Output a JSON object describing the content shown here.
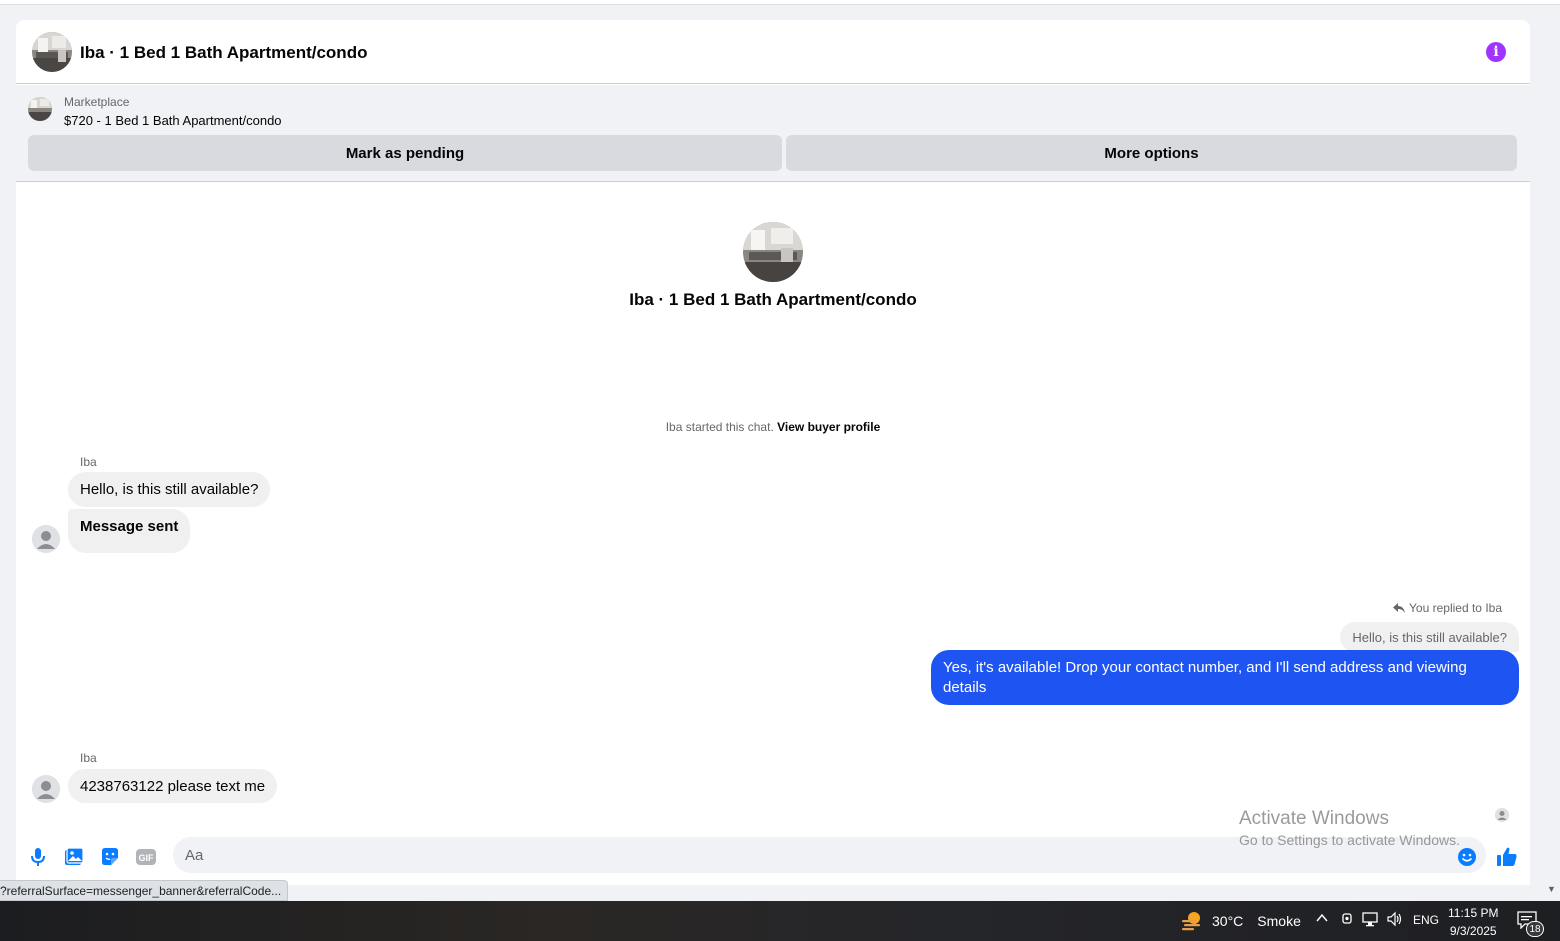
{
  "header": {
    "title": "Iba · 1 Bed 1 Bath Apartment/condo",
    "info_icon": "info-icon",
    "info_label": "i"
  },
  "marketplace": {
    "label": "Marketplace",
    "item": "$720 - 1 Bed 1 Bath Apartment/condo",
    "mark_pending": "Mark as pending",
    "more_options": "More options"
  },
  "intro": {
    "title": "Iba · 1 Bed 1 Bath Apartment/condo",
    "started_text": "Iba started this chat.",
    "view_profile": "View buyer profile"
  },
  "messages": {
    "group1": {
      "sender": "Iba",
      "msg1": "Hello, is this still available?",
      "msg2": "Message sent"
    },
    "reply": {
      "replied_label": "You replied to Iba",
      "quoted": "Hello, is this still available?",
      "text": "Yes, it's available! Drop your contact number, and I'll send address and viewing details"
    },
    "group2": {
      "sender": "Iba",
      "msg1": "4238763122 please text me"
    }
  },
  "composer": {
    "placeholder": "Aa",
    "icons": [
      "microphone-icon",
      "photo-icon",
      "sticker-icon",
      "gif-icon",
      "emoji-icon",
      "like-icon"
    ],
    "gif_label": "GIF"
  },
  "watermark": {
    "title": "Activate Windows",
    "subtitle": "Go to Settings to activate Windows."
  },
  "status_bar": {
    "url": "?referralSurface=messenger_banner&referralCode..."
  },
  "taskbar": {
    "temperature": "30°C",
    "weather": "Smoke",
    "language": "ENG",
    "time": "11:15 PM",
    "date": "9/3/2025",
    "notifications": "18"
  },
  "colors": {
    "accent": "#1e55f2",
    "info": "#a033ff",
    "composer_icon": "#0a7cff"
  }
}
